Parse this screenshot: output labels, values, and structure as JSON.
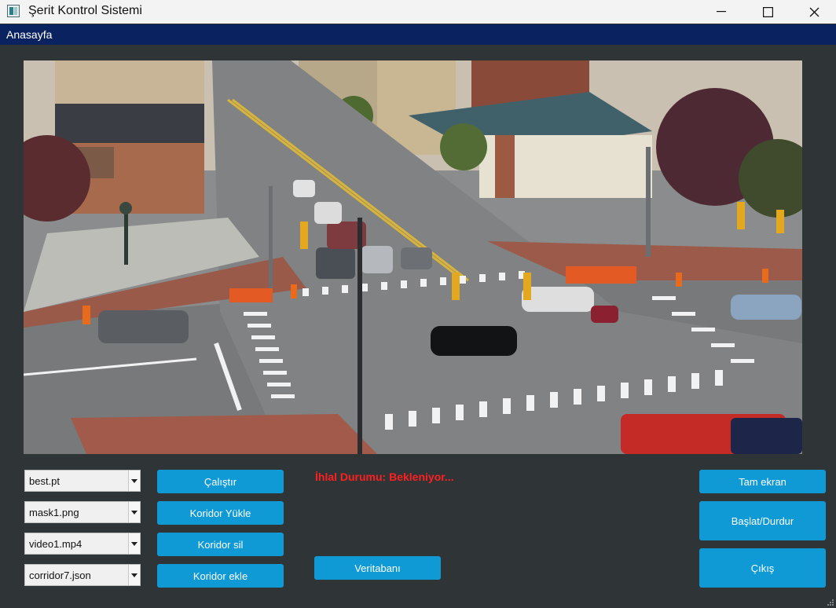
{
  "window": {
    "title": "Şerit Kontrol Sistemi",
    "icon": "app-window-icon",
    "controls": {
      "minimize": "—",
      "maximize": "☐",
      "close": "✕"
    }
  },
  "menu": {
    "items": [
      {
        "label": "Anasayfa"
      }
    ]
  },
  "video": {
    "content": "traffic-intersection-camera-feed"
  },
  "left_combos": [
    {
      "value": "best.pt"
    },
    {
      "value": "mask1.png"
    },
    {
      "value": "video1.mp4"
    },
    {
      "value": "corridor7.json"
    }
  ],
  "mid_buttons": {
    "run": "Çalıştır",
    "load_corridor": "Koridor Yükle",
    "delete_corridor": "Koridor sil",
    "add_corridor": "Koridor ekle"
  },
  "status": {
    "text": "İhlal Durumu: Bekleniyor..."
  },
  "database_button": "Veritabanı",
  "right_buttons": {
    "fullscreen": "Tam ekran",
    "start_stop": "Başlat/Durdur",
    "exit": "Çıkış"
  },
  "colors": {
    "background": "#2f3437",
    "menubar": "#0a2260",
    "button": "#0f9ad6",
    "status": "#ff1f1f"
  }
}
